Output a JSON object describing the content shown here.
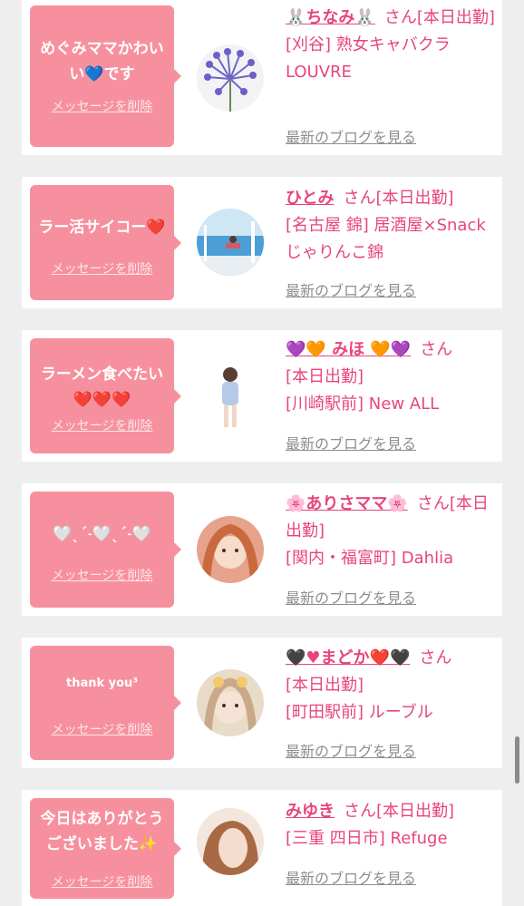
{
  "delete_label": "メッセージを削除",
  "blog_link_label": "最新のブログを見る",
  "san_suffix": "さん",
  "cards": [
    {
      "message": "めぐみママかわいい💙です",
      "name": "🐰ちなみ🐰",
      "status": "[本日出勤]",
      "area": "[刈谷]",
      "shop": "熟女キャバクラ LOUVRE",
      "avatar_icon": "flower-photo"
    },
    {
      "message": "ラー活サイコー❤️",
      "name": "ひとみ",
      "status": "[本日出勤]",
      "area": "[名古屋 錦]",
      "shop": "居酒屋×Snack じゃりんこ錦",
      "avatar_icon": "beach-photo"
    },
    {
      "message": "ラーメン食べたい❤️❤️❤️",
      "name": "💜🧡 みほ 🧡💜",
      "status": "[本日出勤]",
      "area": "[川崎駅前]",
      "shop": "New ALL",
      "avatar_icon": "girl-photo"
    },
    {
      "message": "🤍ˎˊ˗🤍ˎˊ˗🤍",
      "name": "🌸ありさママ🌸",
      "status": "[本日出勤]",
      "area": "[関内・福富町]",
      "shop": "Dahlia",
      "avatar_icon": "selfie-photo"
    },
    {
      "message": "thank you³",
      "name": "🖤♥まどか❤️🖤",
      "status": "[本日出勤]",
      "area": "[町田駅前]",
      "shop": "ルーブル",
      "avatar_icon": "selfie-photo"
    },
    {
      "message": "今日はありがとうございました✨",
      "name": "みゆき",
      "status": "[本日出勤]",
      "area": "[三重 四日市]",
      "shop": "Refuge",
      "avatar_icon": "portrait-photo"
    }
  ]
}
